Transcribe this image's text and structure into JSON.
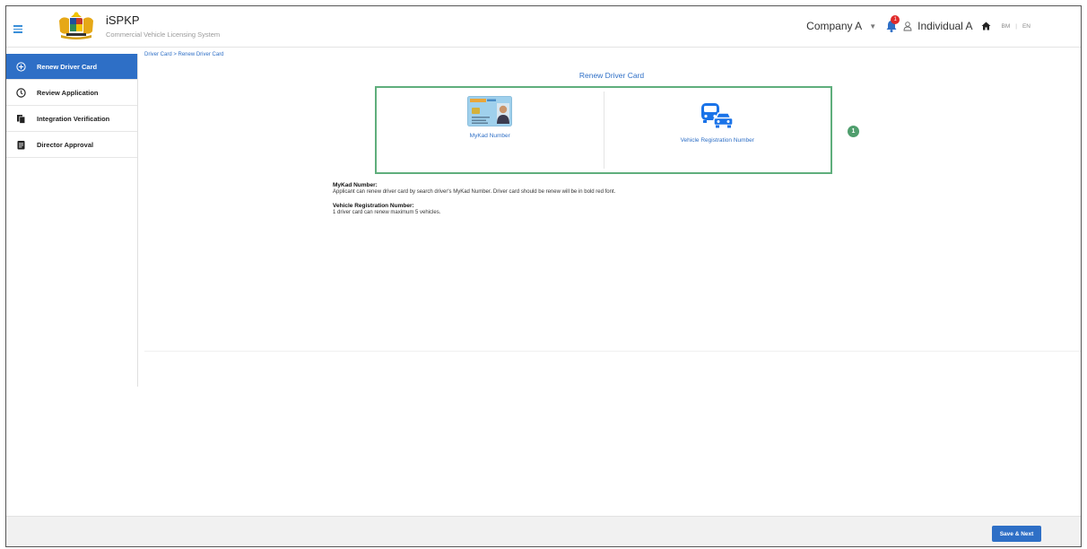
{
  "app": {
    "title": "iSPKP",
    "subtitle": "Commercial Vehicle Licensing System"
  },
  "header": {
    "company": "Company A",
    "notification_count": "1",
    "user": "Individual A",
    "lang_bm": "BM",
    "lang_sep": "|",
    "lang_en": "EN"
  },
  "sidebar": {
    "items": [
      {
        "label": "Renew Driver Card",
        "icon": "plus-circle-icon",
        "active": true
      },
      {
        "label": "Review Application",
        "icon": "clock-icon",
        "active": false
      },
      {
        "label": "Integration Verification",
        "icon": "documents-icon",
        "active": false
      },
      {
        "label": "Director Approval",
        "icon": "clipboard-icon",
        "active": false
      }
    ]
  },
  "main": {
    "breadcrumb": "Driver Card > Renew Driver Card",
    "page_title": "Renew Driver Card",
    "options": [
      {
        "label": "MyKad Number",
        "icon": "mykad-card-icon"
      },
      {
        "label": "Vehicle Registration Number",
        "icon": "vehicles-icon"
      }
    ],
    "step_badge": "1",
    "notes": [
      {
        "heading": "MyKad Number:",
        "body": "Applicant can renew driver card by search driver's MyKad Number. Driver card should be renew will be in bold red font."
      },
      {
        "heading": "Vehicle Registration Number:",
        "body": "1 driver card can renew maximum 5 vehicles."
      }
    ]
  },
  "footer": {
    "save_next": "Save & Next"
  },
  "colors": {
    "primary": "#2e6fc6",
    "highlight_border": "#5fae7c",
    "badge_red": "#e02b2b"
  }
}
